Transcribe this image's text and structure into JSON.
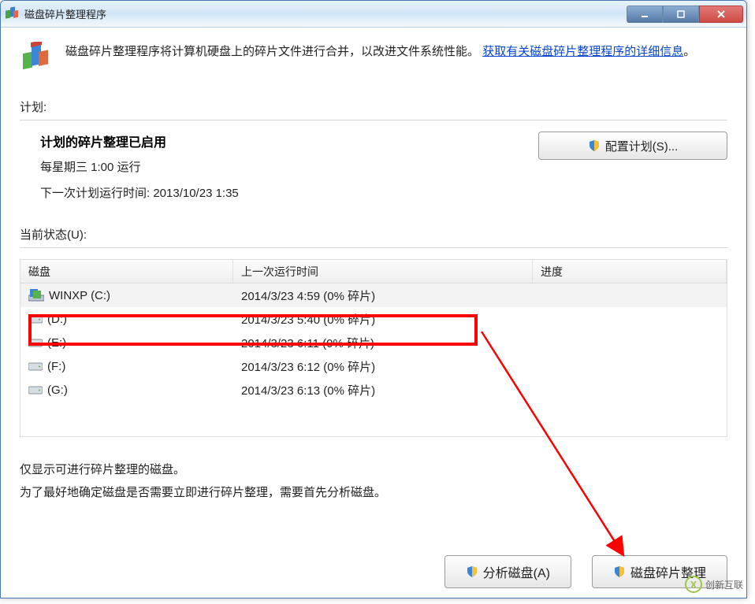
{
  "window": {
    "title": "磁盘碎片整理程序"
  },
  "intro": {
    "text_before_link": "磁盘碎片整理程序将计算机硬盘上的碎片文件进行合并，以改进文件系统性能。",
    "link_text": "获取有关磁盘碎片整理程序的详细信息",
    "period": "。"
  },
  "sections": {
    "schedule_label": "计划:",
    "status_label": "当前状态(U):"
  },
  "schedule": {
    "heading": "计划的碎片整理已启用",
    "line1": "每星期三  1:00 运行",
    "line2": "下一次计划运行时间: 2013/10/23 1:35",
    "configure_btn": "配置计划(S)..."
  },
  "table": {
    "cols": {
      "disk": "磁盘",
      "last": "上一次运行时间",
      "progress": "进度"
    },
    "rows": [
      {
        "name": "WINXP (C:)",
        "last": "2014/3/23 4:59 (0% 碎片)",
        "icon": "c"
      },
      {
        "name": "(D:)",
        "last": "2014/3/23 5:40 (0% 碎片)",
        "icon": "d"
      },
      {
        "name": "(E:)",
        "last": "2014/3/23 6:11 (0% 碎片)",
        "icon": "d"
      },
      {
        "name": "(F:)",
        "last": "2014/3/23 6:12 (0% 碎片)",
        "icon": "d"
      },
      {
        "name": "(G:)",
        "last": "2014/3/23 6:13 (0% 碎片)",
        "icon": "d"
      }
    ]
  },
  "note": {
    "line1": "仅显示可进行碎片整理的磁盘。",
    "line2": "为了最好地确定磁盘是否需要立即进行碎片整理，需要首先分析磁盘。"
  },
  "buttons": {
    "analyze": "分析磁盘(A)",
    "defrag": "磁盘碎片整理"
  },
  "watermark": "创新互联"
}
